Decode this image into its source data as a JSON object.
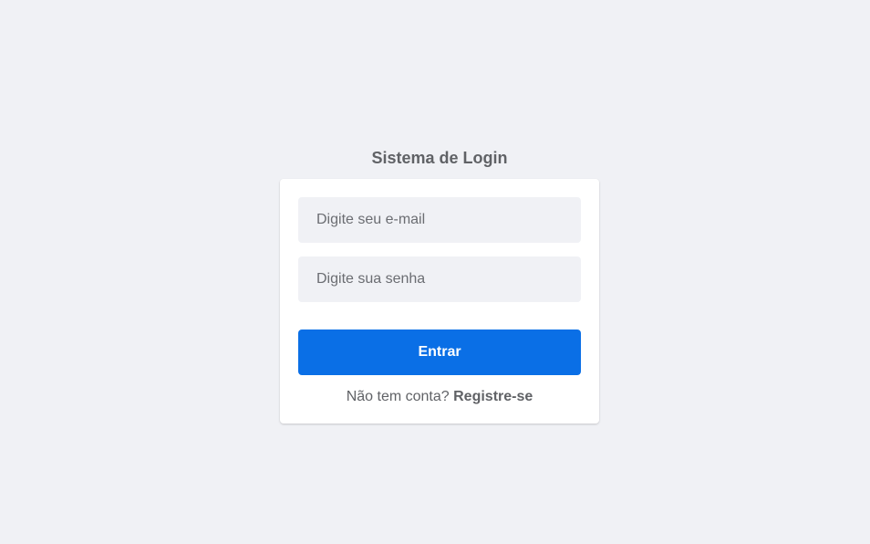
{
  "login": {
    "title": "Sistema de Login",
    "email_placeholder": "Digite seu e-mail",
    "email_value": "",
    "password_placeholder": "Digite sua senha",
    "password_value": "",
    "submit_label": "Entrar",
    "register_prompt": "Não tem conta?",
    "register_link": "Registre-se"
  },
  "colors": {
    "background": "#f0f1f5",
    "card": "#ffffff",
    "input_background": "#f0f1f5",
    "button": "#0a6fe6",
    "text": "#606266"
  }
}
